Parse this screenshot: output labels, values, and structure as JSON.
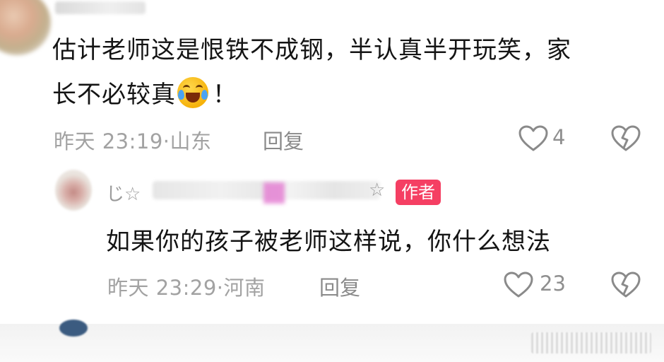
{
  "comment": {
    "text_line1": "估计老师这是恨铁不成钢，半认真半开玩笑，家",
    "text_line2": "长不必较真",
    "text_suffix": "！",
    "emoji": "laughing-crying-emoji",
    "time": "昨天 23:19",
    "location_sep": "·",
    "location": "山东",
    "reply_label": "回复",
    "likes": "4"
  },
  "reply": {
    "name_prefix": "じ☆",
    "name_suffix": "☆",
    "author_badge": "作者",
    "text": "如果你的孩子被老师这样说，你什么想法",
    "time": "昨天 23:29",
    "location_sep": "·",
    "location": "河南",
    "reply_label": "回复",
    "likes": "23"
  },
  "colors": {
    "author_badge": "#f53f63",
    "meta_text": "#a2a2a2",
    "body_text": "#141414"
  }
}
